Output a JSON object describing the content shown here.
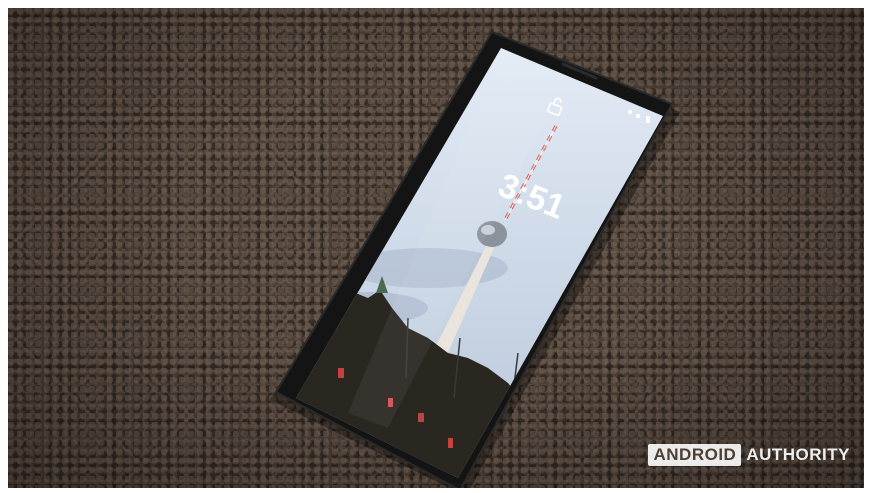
{
  "photo": {
    "subject": "smartphone on carpet",
    "lockscreen_clock": "3:51",
    "lock_icon": "unlock-icon",
    "colors": {
      "carpet": "#4b3f36",
      "bezel": "#141414",
      "sky_top": "#dfe8f4",
      "sky_bottom": "#b9c9dc",
      "tower_red": "#d8483a"
    }
  },
  "watermark": {
    "boxed": "ANDROID",
    "plain": "AUTHORITY"
  }
}
